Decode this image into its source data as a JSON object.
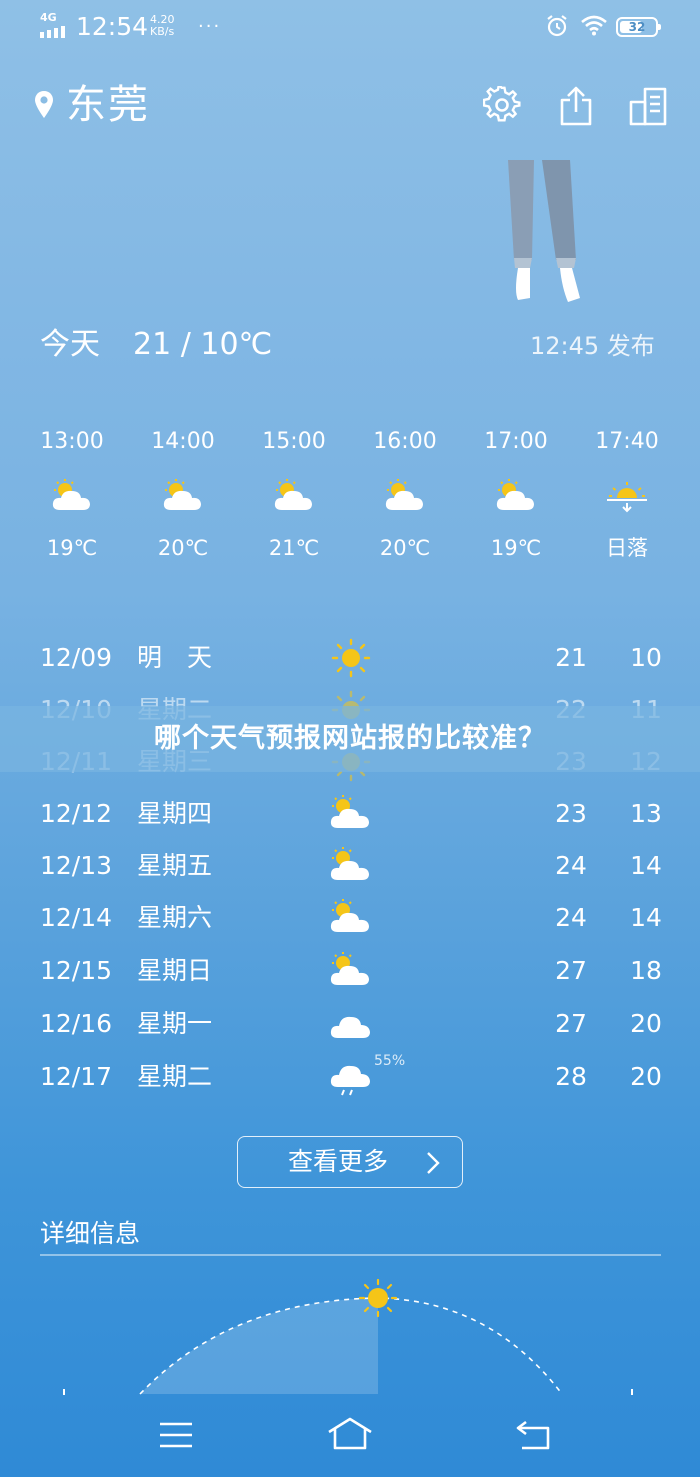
{
  "status_bar": {
    "network": "4G",
    "time": "12:54",
    "speed_value": "4.20",
    "speed_unit": "KB/s",
    "battery": "32"
  },
  "header": {
    "city": "东莞"
  },
  "today": {
    "label": "今天",
    "temp_range": "21 / 10℃",
    "publish_time": "12:45 发布"
  },
  "hourly": [
    {
      "time": "13:00",
      "icon": "partly-cloudy-icon",
      "temp": "19℃"
    },
    {
      "time": "14:00",
      "icon": "partly-cloudy-icon",
      "temp": "20℃"
    },
    {
      "time": "15:00",
      "icon": "partly-cloudy-icon",
      "temp": "21℃"
    },
    {
      "time": "16:00",
      "icon": "partly-cloudy-icon",
      "temp": "20℃"
    },
    {
      "time": "17:00",
      "icon": "partly-cloudy-icon",
      "temp": "19℃"
    },
    {
      "time": "17:40",
      "icon": "sunset-icon",
      "temp": "日落"
    }
  ],
  "daily": [
    {
      "date": "12/09",
      "weekday": "明　天",
      "icon": "sunny-icon",
      "high": "21",
      "low": "10",
      "precip": ""
    },
    {
      "date": "12/10",
      "weekday": "星期二",
      "icon": "sunny-icon",
      "high": "22",
      "low": "11",
      "precip": ""
    },
    {
      "date": "12/11",
      "weekday": "星期三",
      "icon": "sunny-icon",
      "high": "23",
      "low": "12",
      "precip": ""
    },
    {
      "date": "12/12",
      "weekday": "星期四",
      "icon": "partly-cloudy-icon",
      "high": "23",
      "low": "13",
      "precip": ""
    },
    {
      "date": "12/13",
      "weekday": "星期五",
      "icon": "partly-cloudy-icon",
      "high": "24",
      "low": "14",
      "precip": ""
    },
    {
      "date": "12/14",
      "weekday": "星期六",
      "icon": "partly-cloudy-icon",
      "high": "24",
      "low": "14",
      "precip": ""
    },
    {
      "date": "12/15",
      "weekday": "星期日",
      "icon": "partly-cloudy-icon",
      "high": "27",
      "low": "18",
      "precip": ""
    },
    {
      "date": "12/16",
      "weekday": "星期一",
      "icon": "cloudy-icon",
      "high": "27",
      "low": "20",
      "precip": ""
    },
    {
      "date": "12/17",
      "weekday": "星期二",
      "icon": "rain-icon",
      "high": "28",
      "low": "20",
      "precip": "55%"
    }
  ],
  "banner": {
    "text": "哪个天气预报网站报的比较准？"
  },
  "more_button": {
    "label": "查看更多"
  },
  "detail": {
    "title": "详细信息"
  },
  "colors": {
    "sun": "#f5c518",
    "cloud": "#ffffff"
  }
}
